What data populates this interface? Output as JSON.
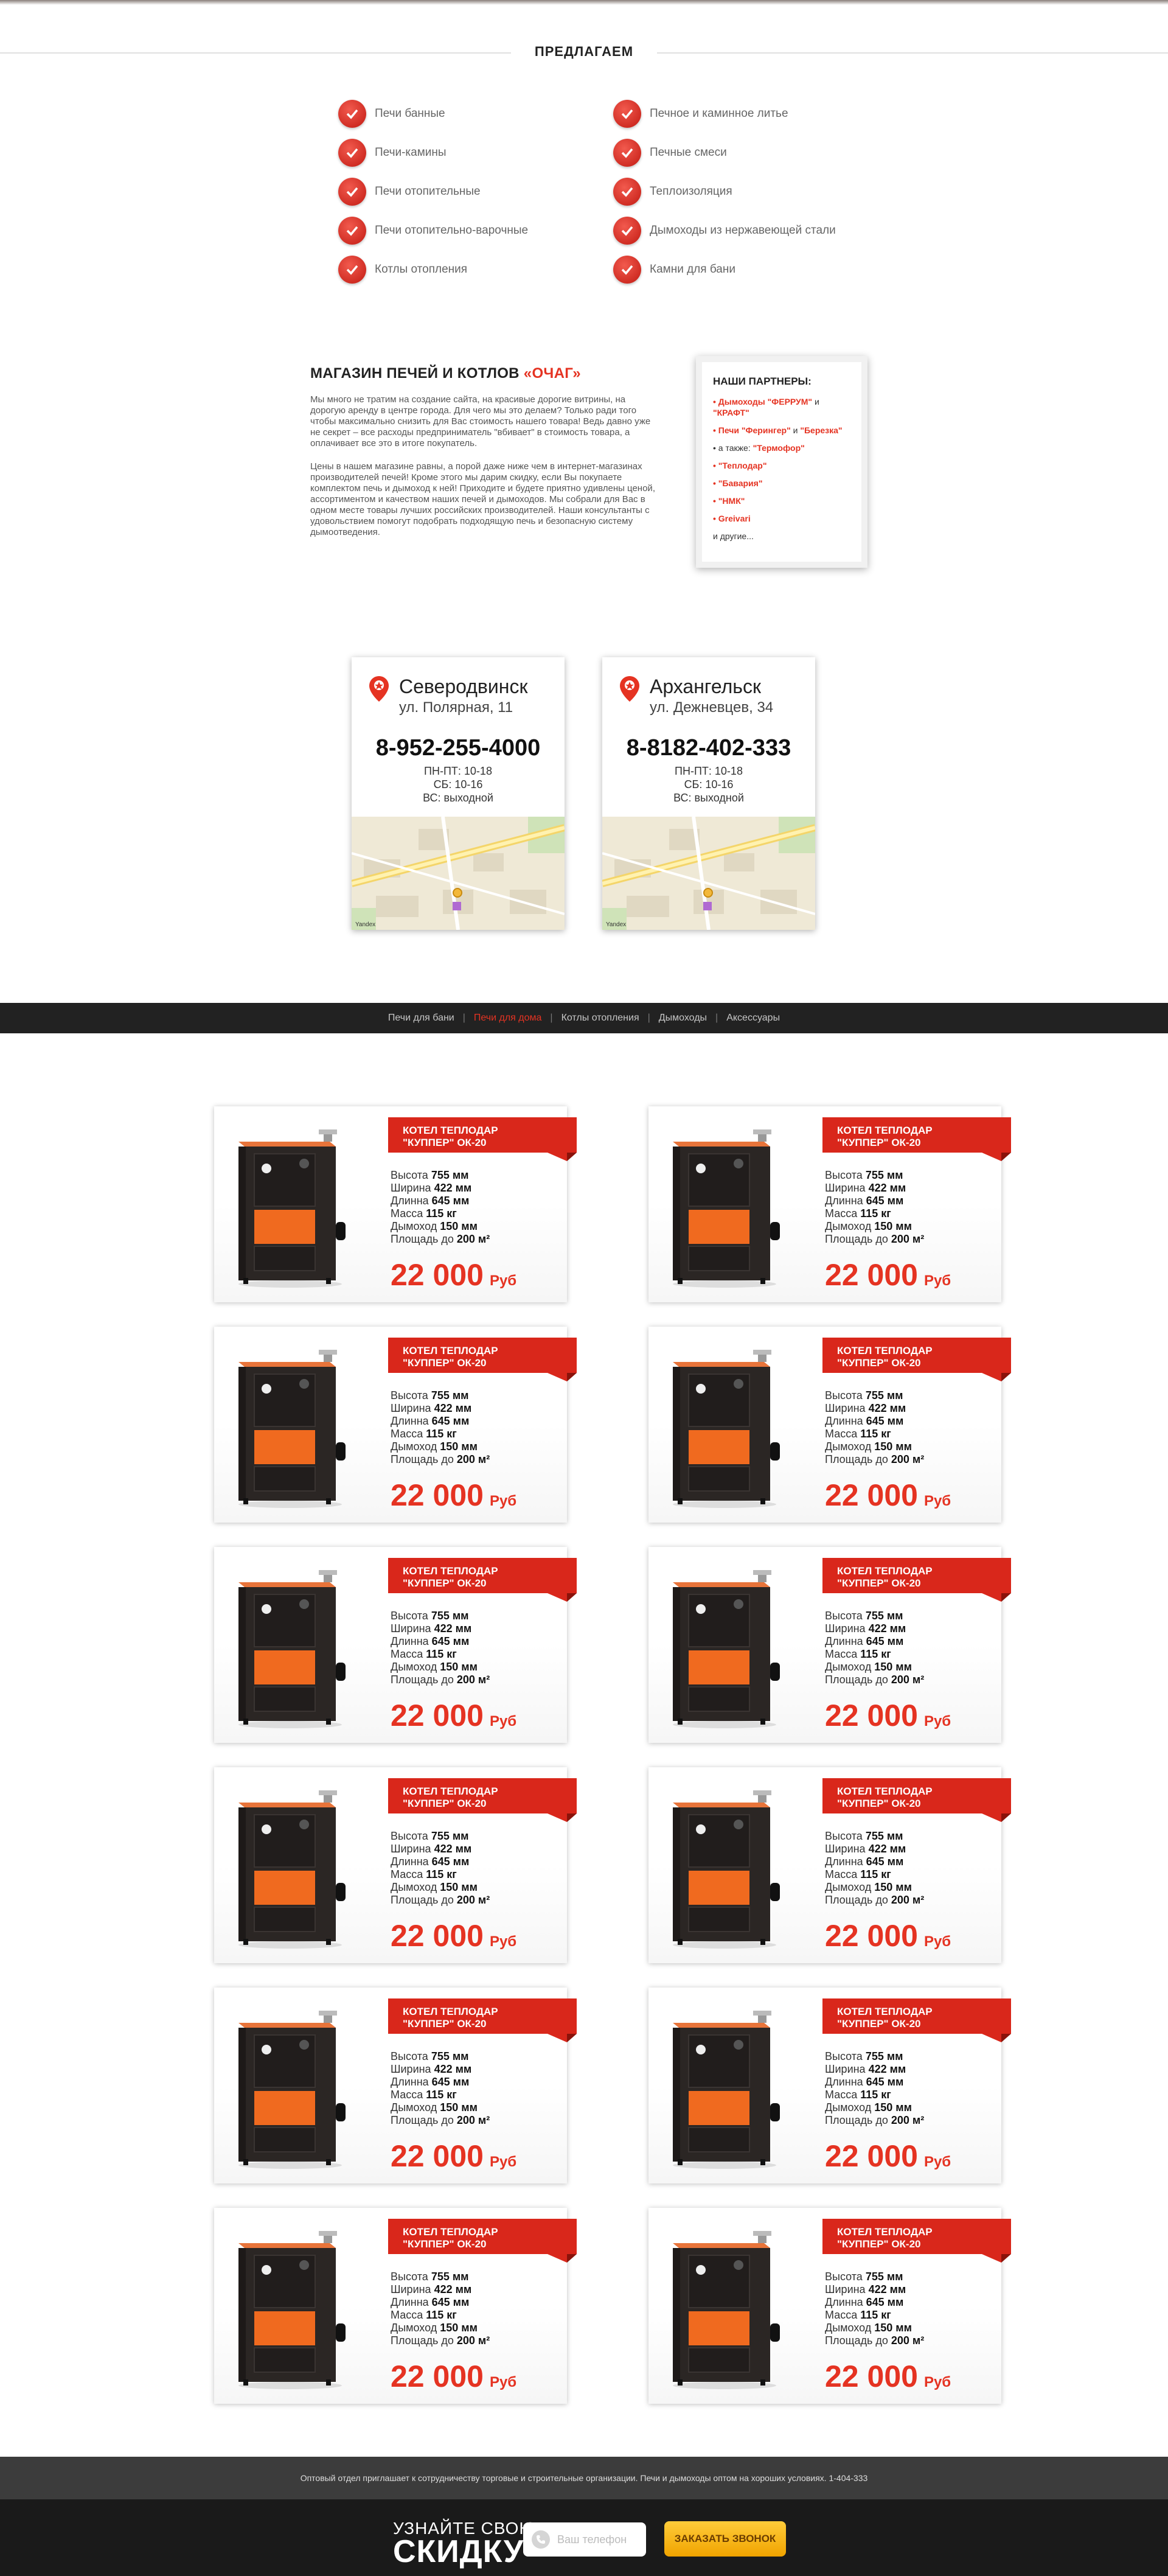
{
  "offers": {
    "title": "ПРЕДЛАГАЕМ",
    "left": [
      "Печи банные",
      "Печи-камины",
      "Печи отопительные",
      "Печи отопительно-варочные",
      "Котлы отопления"
    ],
    "right": [
      "Печное и каминное литье",
      "Печные смеси",
      "Теплоизоляция",
      "Дымоходы из нержавеющей стали",
      "Камни для бани"
    ]
  },
  "about": {
    "title_main": "МАГАЗИН ПЕЧЕЙ И КОТЛОВ ",
    "title_accent": "«ОЧАГ»",
    "p1": "Мы много не тратим на создание сайта, на красивые дорогие витрины, на дорогую аренду в центре города. Для чего мы это делаем? Только ради того чтобы максимально снизить для Вас стоимость нашего товара! Ведь давно уже не секрет – все расходы предприниматель \"вбивает\" в стоимость товара, а оплачивает все это в итоге покупатель.",
    "p2": "Цены в нашем магазине равны, а порой даже ниже чем в интернет-магазинах производителей печей! Кроме этого мы дарим скидку, если Вы покупаете комплектом печь и дымоход к ней! Приходите и будете приятно удивлены ценой, ассортиментом и качеством наших печей и дымоходов. Мы собрали для Вас в одном месте товары лучших российских производителей. Наши консультанты с удовольствием помогут подобрать подходящую печь и безопасную систему дымоотведения."
  },
  "partners": {
    "title": "НАШИ ПАРТНЕРЫ:",
    "l1": "Дымоходы \"ФЕРРУМ\"",
    "l1_and": " и ",
    "l1_b": "\"КРАФТ\"",
    "l2": "Печи \"Ферингер\"",
    "l2_and": " и ",
    "l2_b": "\"Березка\"",
    "l3_pre": "а также: ",
    "l3": "\"Термофор\"",
    "l4": "\"Теплодар\"",
    "l5": "\"Бавария\"",
    "l6": "\"НМК\"",
    "l7": "Greivari",
    "more": "и другие..."
  },
  "stores": [
    {
      "city": "Северодвинск",
      "addr": "ул. Полярная, 11",
      "phone": "8-952-255-4000",
      "h1": "ПН-ПТ: 10-18",
      "h2": "СБ: 10-16",
      "h3": "ВС: выходной",
      "map_label": "Yandex"
    },
    {
      "city": "Архангельск",
      "addr": "ул. Дежневцев, 34",
      "phone": "8-8182-402-333",
      "h1": "ПН-ПТ: 10-18",
      "h2": "СБ: 10-16",
      "h3": "ВС: выходной",
      "map_label": "Yandex"
    }
  ],
  "nav": [
    "Печи для бани",
    "Печи для дома",
    "Котлы отопления",
    "Дымоходы",
    "Аксессуары"
  ],
  "product": {
    "title_line1": "КОТЕЛ ТЕПЛОДАР",
    "title_line2": "\"КУППЕР\" ОК-20",
    "height_label": "Высота ",
    "height_val": "755 мм",
    "width_label": "Ширина ",
    "width_val": "422 мм",
    "length_label": "Длинна ",
    "length_val": "645 мм",
    "mass_label": "Масса ",
    "mass_val": "115 кг",
    "flue_label": "Дымоход ",
    "flue_val": "150 мм",
    "area_label": "Площадь до ",
    "area_val": "200 м²",
    "price": "22 000",
    "currency": "Руб"
  },
  "footer": {
    "wholesale": "Оптовый отдел приглашает к сотрудничеству торговые и строительные организации. Печи и дымоходы оптом на хороших условиях. 1-404-333",
    "discount_small": "УЗНАЙТЕ СВОЮ",
    "discount_big": "СКИДКУ",
    "phone_placeholder": "Ваш телефон",
    "button": "ЗАКАЗАТЬ ЗВОНОК"
  },
  "colors": {
    "accent": "#e53322",
    "nav_bg": "#222222",
    "button": "#f5b400"
  }
}
